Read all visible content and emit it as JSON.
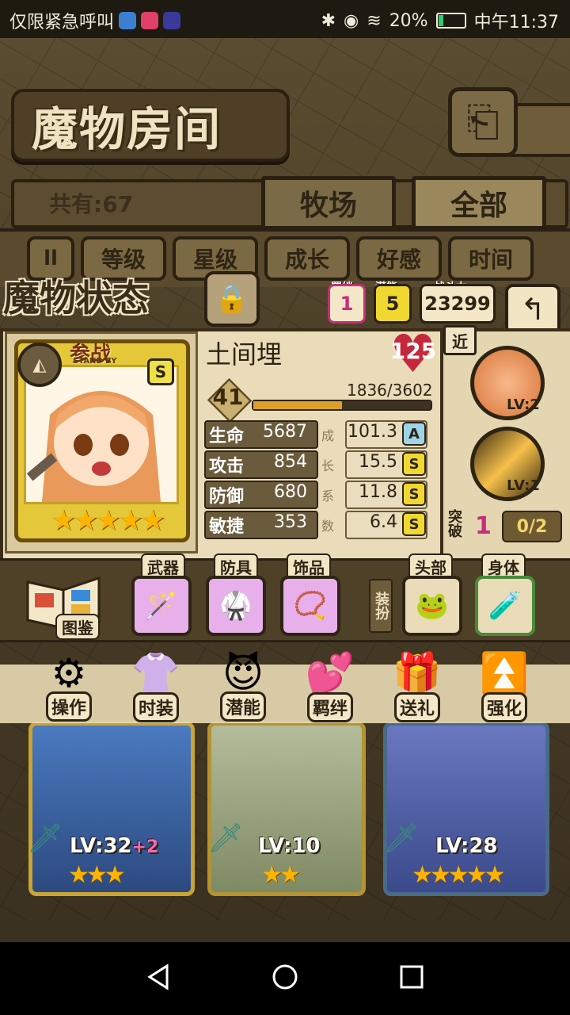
{
  "status_bar": {
    "carrier": "仅限紧急呼叫",
    "battery": "20%",
    "time": "中午11:37"
  },
  "header": {
    "title": "魔物房间",
    "count": "共有:67",
    "tabs": [
      "牧场",
      "全部"
    ]
  },
  "filters": {
    "pause": "ll",
    "items": [
      "等级",
      "星级",
      "成长",
      "好感",
      "时间"
    ]
  },
  "status": {
    "title": "魔物状态",
    "bond_caption": "羁绊",
    "bond": "1",
    "potential_caption": "潜能",
    "potential": "5",
    "power_caption": "战斗力",
    "power": "23299"
  },
  "monster": {
    "name": "土间埋",
    "affection": "125",
    "level": "41",
    "exp": "1836/3602",
    "exp_fraction": 0.51,
    "standby": "参战",
    "standby_en": "STAND BY",
    "rank": "S",
    "stars": 5,
    "stats": [
      {
        "label": "生命",
        "value": "5687",
        "growth": "101.3",
        "grade": "A",
        "char": "成"
      },
      {
        "label": "攻击",
        "value": "854",
        "growth": "15.5",
        "grade": "S",
        "char": "长"
      },
      {
        "label": "防御",
        "value": "680",
        "growth": "11.8",
        "grade": "S",
        "char": "系"
      },
      {
        "label": "敏捷",
        "value": "353",
        "growth": "6.4",
        "grade": "S",
        "char": "数"
      }
    ]
  },
  "skills": {
    "range": "近",
    "items": [
      {
        "level": "LV:2"
      },
      {
        "level": "LV:1"
      }
    ],
    "break_label": "突破",
    "break_value": "1",
    "break_progress": "0/2"
  },
  "equipment": {
    "book_label": "图鉴",
    "slots": [
      {
        "caption": "武器",
        "icon": "wand-icon"
      },
      {
        "caption": "防具",
        "icon": "armor-icon"
      },
      {
        "caption": "饰品",
        "icon": "necklace-icon"
      }
    ],
    "dress_label": "装扮",
    "dress_slots": [
      {
        "caption": "头部",
        "icon": "hat-icon"
      },
      {
        "caption": "身体",
        "icon": "potion-icon"
      }
    ]
  },
  "actions": [
    "操作",
    "时装",
    "潜能",
    "羁绊",
    "送礼",
    "强化"
  ],
  "cards": [
    {
      "level": "LV:32",
      "plus": "+2",
      "stars": 3
    },
    {
      "level": "LV:10",
      "plus": "",
      "stars": 2
    },
    {
      "level": "LV:28",
      "plus": "",
      "stars": 5
    }
  ],
  "colors": {
    "accent_pink": "#c62e7c",
    "gold": "#e4c83a",
    "heart": "#c6283b"
  }
}
